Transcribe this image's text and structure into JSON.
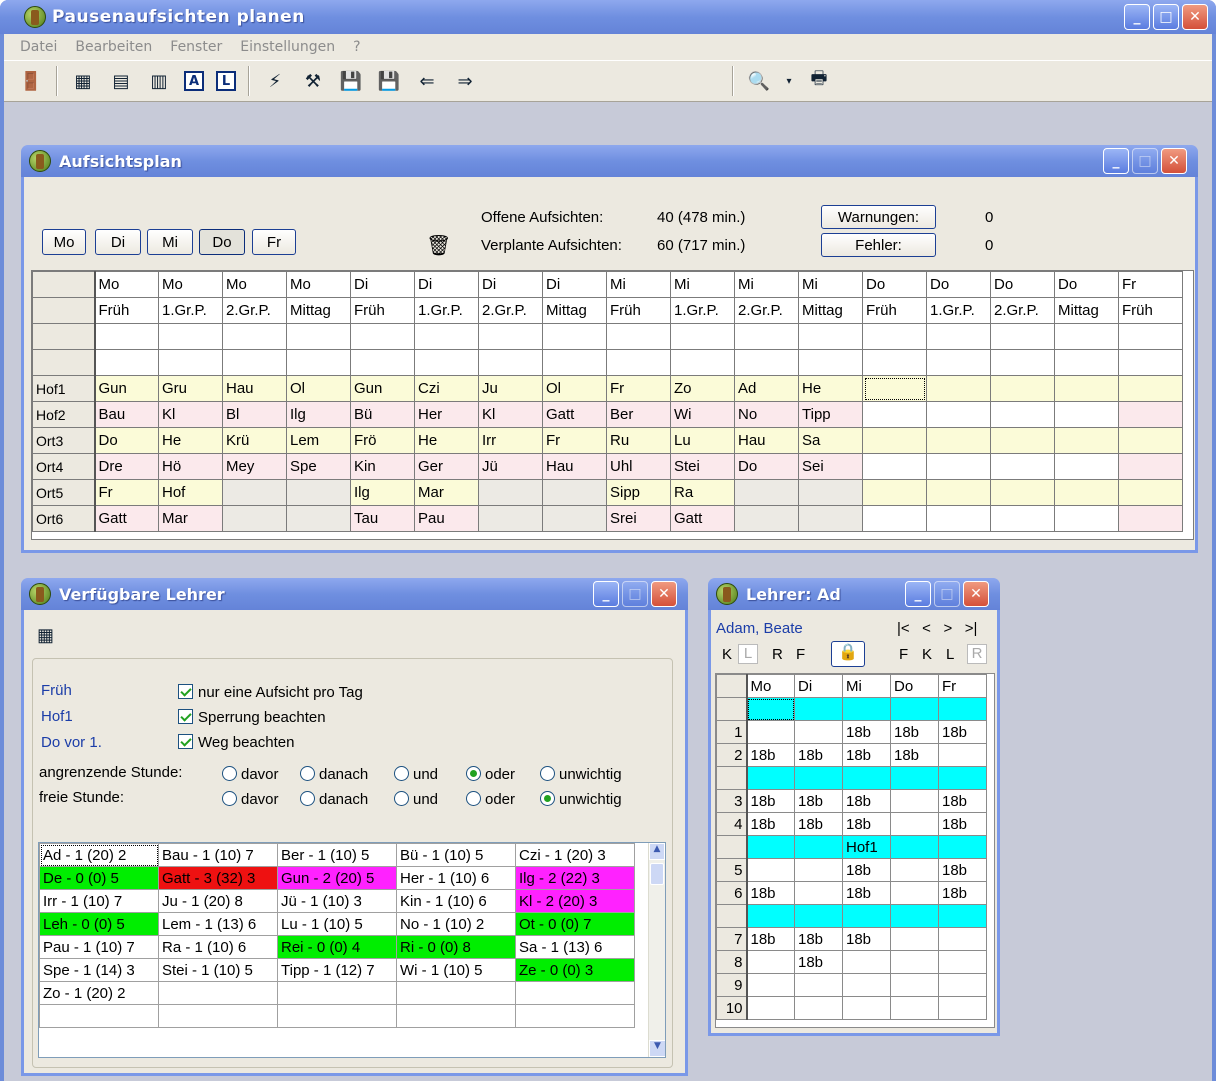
{
  "app": {
    "title": "Pausenaufsichten planen"
  },
  "menu": [
    "Datei",
    "Bearbeiten",
    "Fenster",
    "Einstellungen",
    "?"
  ],
  "toolbar_icons": [
    "exit-icon",
    "table-icon",
    "table-small-icon",
    "table-wide-icon",
    "a-box-icon",
    "l-box-icon",
    "lightning-icon",
    "plan-icon",
    "save-red-icon",
    "save-arrow-icon",
    "arrow-left-icon",
    "arrow-right-icon",
    "preview-icon",
    "print-icon"
  ],
  "toolbar": {
    "a_label": "A",
    "l_label": "L"
  },
  "plan": {
    "title": "Aufsichtsplan",
    "days": [
      "Mo",
      "Di",
      "Mi",
      "Do",
      "Fr"
    ],
    "selected_day": "Do",
    "open_label": "Offene Aufsichten:",
    "open_value": "40 (478 min.)",
    "planned_label": "Verplante Aufsichten:",
    "planned_value": "60 (717 min.)",
    "warnings_label": "Warnungen:",
    "warnings_count": "0",
    "errors_label": "Fehler:",
    "errors_count": "0",
    "col_days": [
      "Mo",
      "Mo",
      "Mo",
      "Mo",
      "Di",
      "Di",
      "Di",
      "Di",
      "Mi",
      "Mi",
      "Mi",
      "Mi",
      "Do",
      "Do",
      "Do",
      "Do",
      "Fr"
    ],
    "col_slots": [
      "Früh",
      "1.Gr.P.",
      "2.Gr.P.",
      "Mittag",
      "Früh",
      "1.Gr.P.",
      "2.Gr.P.",
      "Mittag",
      "Früh",
      "1.Gr.P.",
      "2.Gr.P.",
      "Mittag",
      "Früh",
      "1.Gr.P.",
      "2.Gr.P.",
      "Mittag",
      "Früh"
    ],
    "rows": [
      {
        "label": "Hof1",
        "cells": [
          "Gun",
          "Gru",
          "Hau",
          "Ol",
          "Gun",
          "Czi",
          "Ju",
          "Ol",
          "Fr",
          "Zo",
          "Ad",
          "He",
          "",
          "",
          "",
          "",
          ""
        ]
      },
      {
        "label": "Hof2",
        "cells": [
          "Bau",
          "Kl",
          "Bl",
          "Ilg",
          "Bü",
          "Her",
          "Kl",
          "Gatt",
          "Ber",
          "Wi",
          "No",
          "Tipp",
          "",
          "",
          "",
          "",
          ""
        ]
      },
      {
        "label": "Ort3",
        "cells": [
          "Do",
          "He",
          "Krü",
          "Lem",
          "Frö",
          "He",
          "Irr",
          "Fr",
          "Ru",
          "Lu",
          "Hau",
          "Sa",
          "",
          "",
          "",
          "",
          ""
        ]
      },
      {
        "label": "Ort4",
        "cells": [
          "Dre",
          "Hö",
          "Mey",
          "Spe",
          "Kin",
          "Ger",
          "Jü",
          "Hau",
          "Uhl",
          "Stei",
          "Do",
          "Sei",
          "",
          "",
          "",
          "",
          ""
        ]
      },
      {
        "label": "Ort5",
        "cells": [
          "Fr",
          "Hof",
          "",
          "",
          "Ilg",
          "Mar",
          "",
          "",
          "Sipp",
          "Ra",
          "",
          "",
          "",
          "",
          "",
          "",
          ""
        ]
      },
      {
        "label": "Ort6",
        "cells": [
          "Gatt",
          "Mar",
          "",
          "",
          "Tau",
          "Pau",
          "",
          "",
          "Srei",
          "Gatt",
          "",
          "",
          "",
          "",
          "",
          "",
          ""
        ]
      }
    ]
  },
  "avail": {
    "title": "Verfügbare Lehrer",
    "slot": "Früh",
    "place": "Hof1",
    "when": "Do vor 1.",
    "check1": "nur eine Aufsicht pro Tag",
    "check2": "Sperrung beachten",
    "check3": "Weg beachten",
    "adj_label": "angrenzende Stunde:",
    "free_label": "freie Stunde:",
    "radio_options": [
      "davor",
      "danach",
      "und",
      "oder",
      "unwichtig"
    ],
    "adj_selected": "oder",
    "free_selected": "unwichtig",
    "teachers": [
      [
        "Ad - 1 (20) 2",
        "Bau - 1 (10) 7",
        "Ber - 1 (10) 5",
        "Bü - 1 (10) 5",
        "Czi - 1 (20) 3"
      ],
      [
        "De - 0 (0) 5",
        "Gatt - 3 (32) 3",
        "Gun - 2 (20) 5",
        "Her - 1 (10) 6",
        "Ilg - 2 (22) 3"
      ],
      [
        "Irr - 1 (10) 7",
        "Ju - 1 (20) 8",
        "Jü - 1 (10) 3",
        "Kin - 1 (10) 6",
        "Kl - 2 (20) 3"
      ],
      [
        "Leh - 0 (0) 5",
        "Lem - 1 (13) 6",
        "Lu - 1 (10) 5",
        "No - 1 (10) 2",
        "Ot - 0 (0) 7"
      ],
      [
        "Pau - 1 (10) 7",
        "Ra - 1 (10) 6",
        "Rei - 0 (0) 4",
        "Ri - 0 (0) 8",
        "Sa - 1 (13) 6"
      ],
      [
        "Spe - 1 (14) 3",
        "Stei - 1 (10) 5",
        "Tipp - 1 (12) 7",
        "Wi - 1 (10) 5",
        "Ze - 0 (0) 3"
      ],
      [
        "Zo - 1 (20) 2",
        "",
        "",
        "",
        ""
      ],
      [
        "",
        "",
        "",
        "",
        ""
      ]
    ],
    "colors": {
      "green": "#00ee00",
      "red": "#ee1111",
      "magenta": "#ff22ff"
    }
  },
  "teacher": {
    "title": "Lehrer: Ad",
    "name": "Adam, Beate",
    "nav": [
      "|<",
      "<",
      ">",
      ">|"
    ],
    "left_letters": [
      "K",
      "L",
      "R",
      "F"
    ],
    "right_letters": [
      "F",
      "K",
      "L",
      "R"
    ],
    "days": [
      "Mo",
      "Di",
      "Mi",
      "Do",
      "Fr"
    ],
    "rows": [
      {
        "n": "",
        "cells": [
          "",
          "",
          "",
          "",
          ""
        ],
        "cyan": true
      },
      {
        "n": "1",
        "cells": [
          "",
          "",
          "18b",
          "18b",
          "18b"
        ],
        "cyan": false
      },
      {
        "n": "2",
        "cells": [
          "18b",
          "18b",
          "18b",
          "18b",
          ""
        ],
        "cyan": false
      },
      {
        "n": "",
        "cells": [
          "",
          "",
          "",
          "",
          ""
        ],
        "cyan": true
      },
      {
        "n": "3",
        "cells": [
          "18b",
          "18b",
          "18b",
          "",
          "18b"
        ],
        "cyan": false
      },
      {
        "n": "4",
        "cells": [
          "18b",
          "18b",
          "18b",
          "",
          "18b"
        ],
        "cyan": false
      },
      {
        "n": "",
        "cells": [
          "",
          "",
          "Hof1",
          "",
          ""
        ],
        "cyan": true
      },
      {
        "n": "5",
        "cells": [
          "",
          "",
          "18b",
          "",
          "18b"
        ],
        "cyan": false
      },
      {
        "n": "6",
        "cells": [
          "18b",
          "",
          "18b",
          "",
          "18b"
        ],
        "cyan": false
      },
      {
        "n": "",
        "cells": [
          "",
          "",
          "",
          "",
          ""
        ],
        "cyan": true
      },
      {
        "n": "7",
        "cells": [
          "18b",
          "18b",
          "18b",
          "",
          ""
        ],
        "cyan": false
      },
      {
        "n": "8",
        "cells": [
          "",
          "18b",
          "",
          "",
          ""
        ],
        "cyan": false
      },
      {
        "n": "9",
        "cells": [
          "",
          "",
          "",
          "",
          ""
        ],
        "cyan": false
      },
      {
        "n": "10",
        "cells": [
          "",
          "",
          "",
          "",
          ""
        ],
        "cyan": false
      }
    ]
  },
  "colors": {
    "pink": "#fbe9ec",
    "yellow": "#fbfbd8",
    "cyan": "#00ffff",
    "title_blue": "#6f8fe0"
  }
}
